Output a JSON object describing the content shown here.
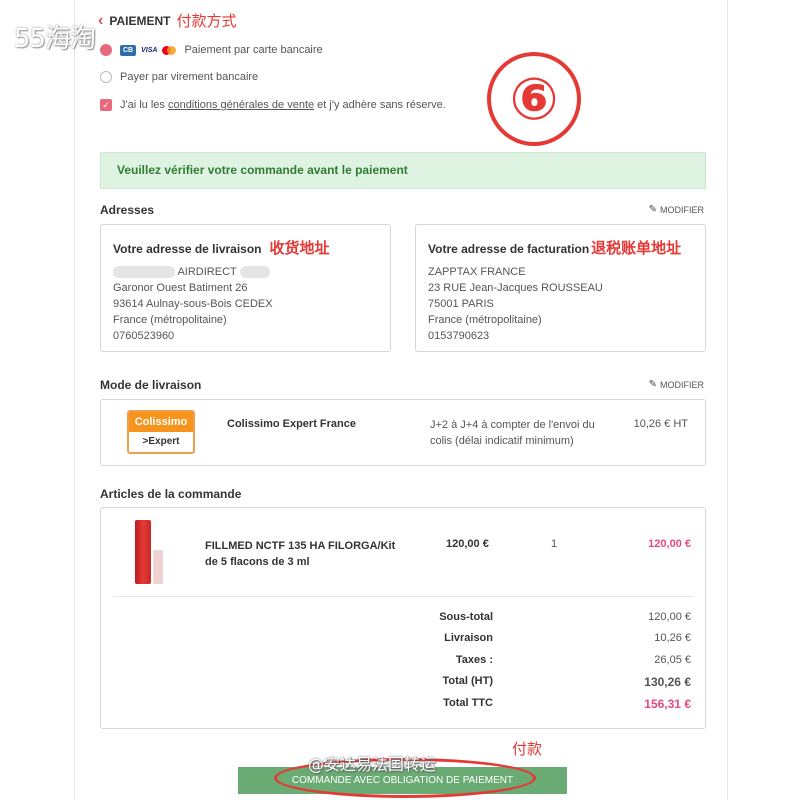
{
  "watermark": "55海淘",
  "payment": {
    "title": "PAIEMENT",
    "note_cn": "付款方式",
    "options": [
      {
        "label": "Paiement par carte bancaire",
        "selected": true,
        "icons": [
          "cb-icon",
          "visa-icon",
          "mastercard-icon"
        ]
      },
      {
        "label": "Payer par virement bancaire",
        "selected": false
      }
    ],
    "cgv": {
      "before": "J'ai lu les ",
      "link": "conditions générales de vente",
      "after": " et j'y adhère sans réserve.",
      "checked": true
    },
    "card_labels": {
      "cb": "CB",
      "visa": "VISA"
    }
  },
  "step_marker": "⑥",
  "verify_banner": "Veuillez vérifier votre commande avant le paiement",
  "addresses": {
    "title": "Adresses",
    "modify": "MODIFIER",
    "delivery": {
      "title": "Votre adresse de livraison",
      "note_cn": "收货地址",
      "company": "AIRDIRECT",
      "lines": [
        "Garonor Ouest Batiment 26",
        "93614 Aulnay-sous-Bois CEDEX",
        "France (métropolitaine)",
        "0760523960"
      ]
    },
    "billing": {
      "title": "Votre adresse de facturation",
      "note_cn": "退税账单地址",
      "lines": [
        "ZAPPTAX FRANCE",
        "23 RUE Jean-Jacques ROUSSEAU",
        "75001 PARIS",
        "France (métropolitaine)",
        "0153790623"
      ]
    }
  },
  "shipping": {
    "title": "Mode de livraison",
    "modify": "MODIFIER",
    "logo_top": "Colissimo",
    "logo_bottom": ">Expert",
    "name": "Colissimo Expert France",
    "delay_line1": "J+2 à J+4 à compter de l'envoi du",
    "delay_line2": "colis (délai indicatif minimum)",
    "price": "10,26 € HT"
  },
  "articles": {
    "title": "Articles de la commande",
    "item": {
      "name_line1": "FILLMED NCTF 135 HA FILORGA/Kit",
      "name_line2": "de 5 flacons de 3 ml",
      "unit_price": "120,00 €",
      "qty": "1",
      "total": "120,00 €"
    },
    "totals": [
      {
        "label": "Sous-total",
        "value": "120,00 €"
      },
      {
        "label": "Livraison",
        "value": "10,26 €"
      },
      {
        "label": "Taxes :",
        "value": "26,05 €"
      },
      {
        "label": "Total (HT)",
        "value": "130,26 €"
      },
      {
        "label": "Total TTC",
        "value": "156,31 €"
      }
    ]
  },
  "pay_note_cn": "付款",
  "weibo_watermark": "@安达易法国转运",
  "pay_button": "COMMANDE AVEC OBLIGATION DE PAIEMENT",
  "colors": {
    "accent": "#e8697d",
    "green": "#6aaa73",
    "annotation_red": "#e53935",
    "price_pink": "#e8497a"
  }
}
